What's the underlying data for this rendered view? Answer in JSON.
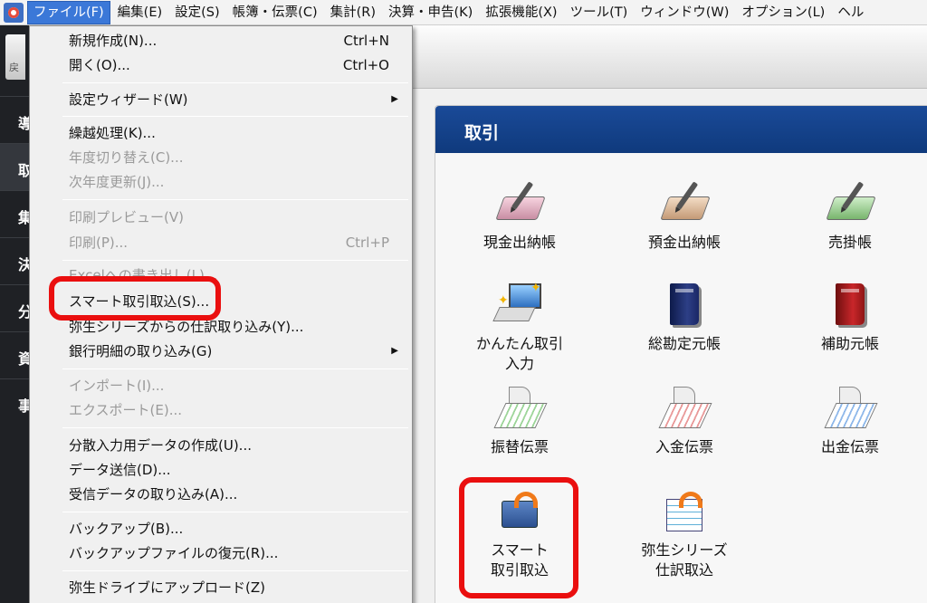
{
  "menubar": {
    "items": [
      "ファイル(F)",
      "編集(E)",
      "設定(S)",
      "帳簿・伝票(C)",
      "集計(R)",
      "決算・申告(K)",
      "拡張機能(X)",
      "ツール(T)",
      "ウィンドウ(W)",
      "オプション(L)",
      "ヘル"
    ],
    "active_index": 0
  },
  "left_strip": {
    "back_label": "戻",
    "items": [
      "導",
      "取",
      "集",
      "決",
      "分",
      "資",
      "事"
    ]
  },
  "file_menu": {
    "items": [
      {
        "label": "新規作成(N)...",
        "shortcut": "Ctrl+N",
        "enabled": true
      },
      {
        "label": "開く(O)...",
        "shortcut": "Ctrl+O",
        "enabled": true
      },
      {
        "label": "設定ウィザード(W)",
        "submenu": true,
        "enabled": true
      },
      {
        "label": "繰越処理(K)...",
        "enabled": true
      },
      {
        "label": "年度切り替え(C)...",
        "enabled": false
      },
      {
        "label": "次年度更新(J)...",
        "enabled": false
      },
      {
        "label": "印刷プレビュー(V)",
        "enabled": false
      },
      {
        "label": "印刷(P)...",
        "shortcut": "Ctrl+P",
        "enabled": false
      },
      {
        "label": "Excelへの書き出し(L)...",
        "enabled": false
      },
      {
        "label": "スマート取引取込(S)...",
        "enabled": true,
        "highlighted": true
      },
      {
        "label": "弥生シリーズからの仕訳取り込み(Y)...",
        "enabled": true
      },
      {
        "label": "銀行明細の取り込み(G)",
        "submenu": true,
        "enabled": true
      },
      {
        "label": "インポート(I)...",
        "enabled": false
      },
      {
        "label": "エクスポート(E)...",
        "enabled": false
      },
      {
        "label": "分散入力用データの作成(U)...",
        "enabled": true
      },
      {
        "label": "データ送信(D)...",
        "enabled": true
      },
      {
        "label": "受信データの取り込み(A)...",
        "enabled": true
      },
      {
        "label": "バックアップ(B)...",
        "enabled": true
      },
      {
        "label": "バックアップファイルの復元(R)...",
        "enabled": true
      },
      {
        "label": "弥生ドライブにアップロード(Z)",
        "enabled": true
      }
    ]
  },
  "panel": {
    "title": "取引",
    "tiles": [
      {
        "label": "現金出納帳",
        "icon": "cash-book-icon"
      },
      {
        "label": "預金出納帳",
        "icon": "deposit-book-icon"
      },
      {
        "label": "売掛帳",
        "icon": "receivable-book-icon"
      },
      {
        "label": "かんたん取引\n入力",
        "icon": "easy-entry-icon"
      },
      {
        "label": "総勘定元帳",
        "icon": "general-ledger-icon"
      },
      {
        "label": "補助元帳",
        "icon": "sub-ledger-icon"
      },
      {
        "label": "振替伝票",
        "icon": "transfer-slip-icon"
      },
      {
        "label": "入金伝票",
        "icon": "receipt-slip-icon"
      },
      {
        "label": "出金伝票",
        "icon": "payment-slip-icon"
      },
      {
        "label": "スマート\n取引取込",
        "icon": "smart-import-icon",
        "highlighted": true
      },
      {
        "label": "弥生シリーズ\n仕訳取込",
        "icon": "yayoi-import-icon"
      }
    ]
  },
  "colors": {
    "highlight": "#ea0f0f",
    "menu_active": "#3b78d8",
    "panel_header": "#0f3a7d"
  }
}
